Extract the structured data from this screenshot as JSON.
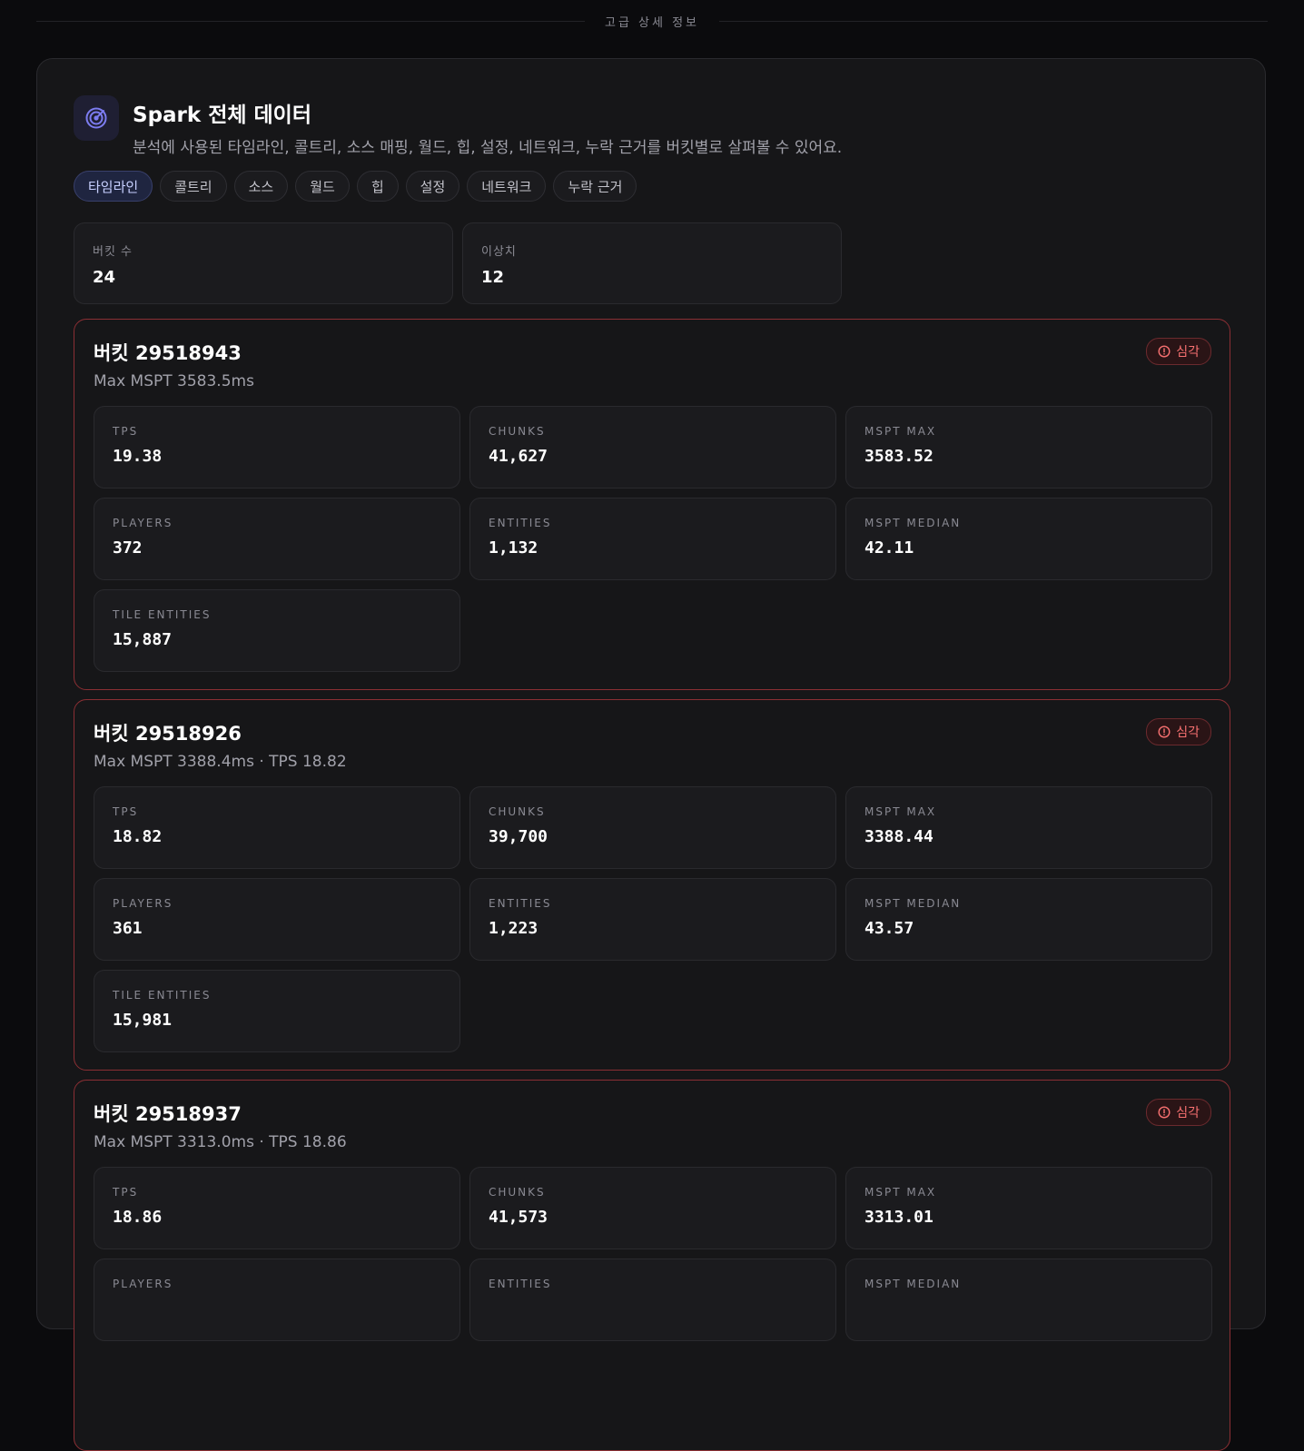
{
  "section_label": "고급 상세 정보",
  "panel": {
    "title": "Spark 전체 데이터",
    "subtitle": "분석에 사용된 타임라인, 콜트리, 소스 매핑, 월드, 힙, 설정, 네트워크, 누락 근거를 버킷별로 살펴볼 수 있어요.",
    "logo_icon": "radar-icon"
  },
  "tabs": [
    {
      "label": "타임라인",
      "active": true
    },
    {
      "label": "콜트리",
      "active": false
    },
    {
      "label": "소스",
      "active": false
    },
    {
      "label": "월드",
      "active": false
    },
    {
      "label": "힙",
      "active": false
    },
    {
      "label": "설정",
      "active": false
    },
    {
      "label": "네트워크",
      "active": false
    },
    {
      "label": "누락 근거",
      "active": false
    }
  ],
  "summary": [
    {
      "label": "버킷 수",
      "value": "24"
    },
    {
      "label": "이상치",
      "value": "12"
    }
  ],
  "buckets": [
    {
      "title": "버킷 29518943",
      "subtitle": "Max MSPT 3583.5ms",
      "badge": "심각",
      "metrics": [
        {
          "label": "TPS",
          "value": "19.38"
        },
        {
          "label": "CHUNKS",
          "value": "41,627"
        },
        {
          "label": "MSPT MAX",
          "value": "3583.52"
        },
        {
          "label": "PLAYERS",
          "value": "372"
        },
        {
          "label": "ENTITIES",
          "value": "1,132"
        },
        {
          "label": "MSPT MEDIAN",
          "value": "42.11"
        },
        {
          "label": "TILE ENTITIES",
          "value": "15,887"
        }
      ]
    },
    {
      "title": "버킷 29518926",
      "subtitle": "Max MSPT 3388.4ms · TPS 18.82",
      "badge": "심각",
      "metrics": [
        {
          "label": "TPS",
          "value": "18.82"
        },
        {
          "label": "CHUNKS",
          "value": "39,700"
        },
        {
          "label": "MSPT MAX",
          "value": "3388.44"
        },
        {
          "label": "PLAYERS",
          "value": "361"
        },
        {
          "label": "ENTITIES",
          "value": "1,223"
        },
        {
          "label": "MSPT MEDIAN",
          "value": "43.57"
        },
        {
          "label": "TILE ENTITIES",
          "value": "15,981"
        }
      ]
    },
    {
      "title": "버킷 29518937",
      "subtitle": "Max MSPT 3313.0ms · TPS 18.86",
      "badge": "심각",
      "metrics": [
        {
          "label": "TPS",
          "value": "18.86"
        },
        {
          "label": "CHUNKS",
          "value": "41,573"
        },
        {
          "label": "MSPT MAX",
          "value": "3313.01"
        },
        {
          "label": "PLAYERS",
          "value": ""
        },
        {
          "label": "ENTITIES",
          "value": ""
        },
        {
          "label": "MSPT MEDIAN",
          "value": ""
        }
      ]
    }
  ],
  "colors": {
    "accent": "#7c7cf0",
    "critical": "#f87171",
    "critical_border": "#8b2f34"
  }
}
